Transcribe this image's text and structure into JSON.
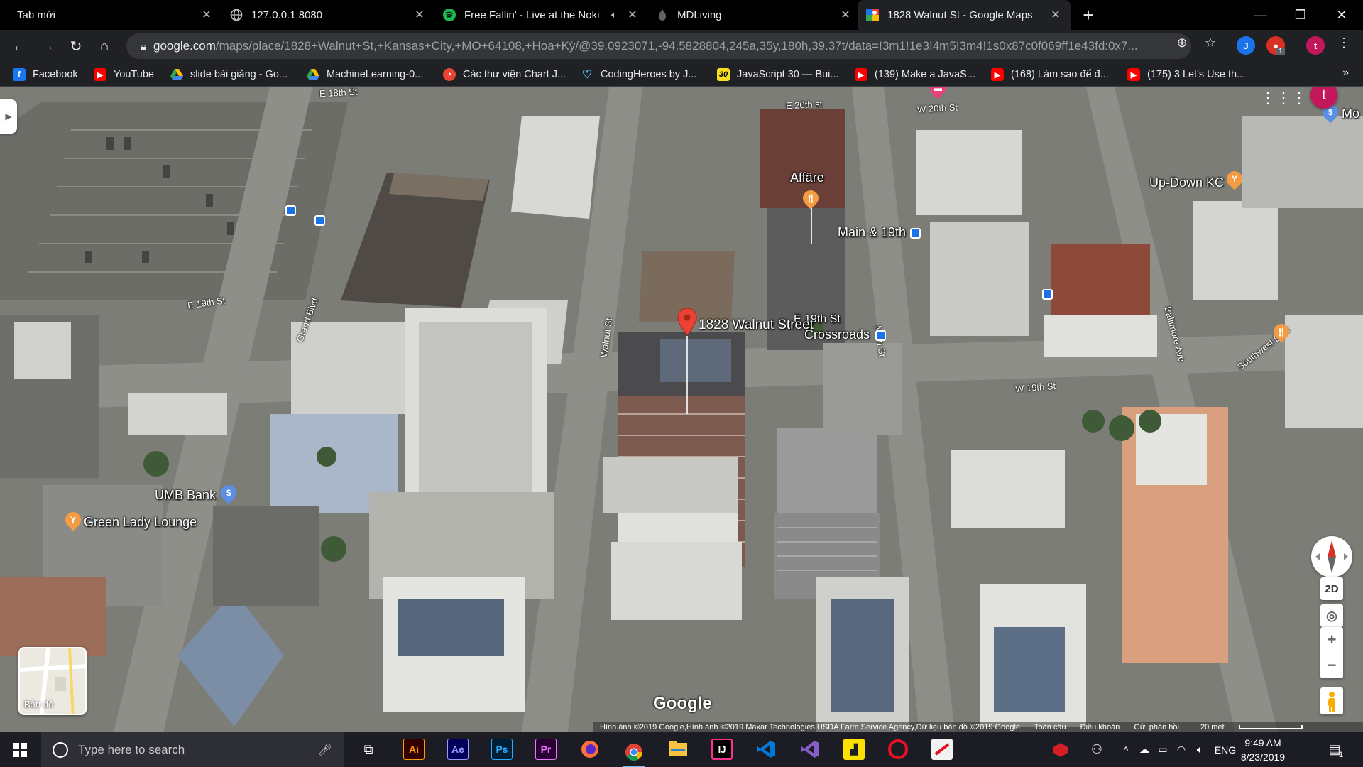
{
  "browser": {
    "tabs": [
      {
        "title": "Tab mới",
        "favicon": "none"
      },
      {
        "title": "127.0.0.1:8080",
        "favicon": "globe-icon"
      },
      {
        "title": "Free Fallin' - Live at the Noki",
        "favicon": "spotify-icon",
        "audio": "speaker-icon"
      },
      {
        "title": "MDLiving",
        "favicon": "drop-icon"
      },
      {
        "title": "1828 Walnut St - Google Maps",
        "favicon": "google-maps-icon"
      }
    ],
    "active_tab": 4,
    "url_host": "google.com",
    "url_path": "/maps/place/1828+Walnut+St,+Kansas+City,+MO+64108,+Hoa+Kỳ/@39.0923071,-94.5828804,245a,35y,180h,39.37t/data=!3m1!1e3!4m5!3m4!1s0x87c0f069ff1e43fd:0x7...",
    "profile_initial": "t",
    "extension_badge": "1"
  },
  "bookmarks": [
    {
      "label": "Facebook",
      "icon": "facebook-icon",
      "color": "#1877f2"
    },
    {
      "label": "YouTube",
      "icon": "youtube-icon",
      "color": "#ff0000"
    },
    {
      "label": "slide bài giảng - Go...",
      "icon": "drive-icon",
      "color": "#fbbc04"
    },
    {
      "label": "MachineLearning-0...",
      "icon": "drive-icon",
      "color": "#34a853"
    },
    {
      "label": "Các thư viện Chart J...",
      "icon": "chart-icon",
      "color": "#ea4335"
    },
    {
      "label": "CodingHeroes by J...",
      "icon": "heart-icon",
      "color": "#4fc3f7"
    },
    {
      "label": "JavaScript 30 — Bui...",
      "icon": "js30-icon",
      "color": "#f7df1e"
    },
    {
      "label": "(139) Make a JavaS...",
      "icon": "youtube-icon",
      "color": "#ff0000"
    },
    {
      "label": "(168) Làm sao để đ...",
      "icon": "youtube-icon",
      "color": "#ff0000"
    },
    {
      "label": "(175) 3 Let's Use th...",
      "icon": "youtube-icon",
      "color": "#ff0000"
    }
  ],
  "map": {
    "place_label": "1828 Walnut Street",
    "labels": {
      "affare": "Affäre",
      "main19": "Main & 19th",
      "updown": "Up-Down KC",
      "crossroads_a": "E 19th St",
      "crossroads_b": "Crossroads",
      "umb": "UMB Bank",
      "greenlady": "Green Lady Lounge",
      "mo": "Mo"
    },
    "streets": {
      "e19th": "E 19th St",
      "w19th": "W 19th St",
      "grand": "Grand Blvd",
      "walnut": "Walnut St",
      "main": "Main St",
      "baltimore": "Baltimore Ave",
      "southwest": "Southwest Blvd",
      "e20th": "E 20th st",
      "w20th": "W 20th St",
      "e18th": "E 18th St"
    },
    "layer_label": "Bản đồ",
    "view_mode": "2D",
    "google_logo": "Google",
    "attribution": "Hình ảnh ©2019 Google,Hình ảnh ©2019 Maxar Technologies,USDA Farm Service Agency,Dữ liệu bản đồ ©2019 Google",
    "terms_links": [
      "Toàn cầu",
      "Điều khoản",
      "Gửi phản hồi"
    ],
    "scale": "20 mét",
    "user_initial": "t"
  },
  "taskbar": {
    "search_placeholder": "Type here to search",
    "apps": [
      {
        "label": "Ai",
        "color": "#ff9a00",
        "bg": "#330000"
      },
      {
        "label": "Ae",
        "color": "#9999ff",
        "bg": "#00005b"
      },
      {
        "label": "Ps",
        "color": "#31a8ff",
        "bg": "#001e36"
      },
      {
        "label": "Pr",
        "color": "#ea77ff",
        "bg": "#2a0033"
      }
    ],
    "language": "ENG",
    "time": "9:49 AM",
    "date": "8/23/2019",
    "notification_count": "1"
  }
}
